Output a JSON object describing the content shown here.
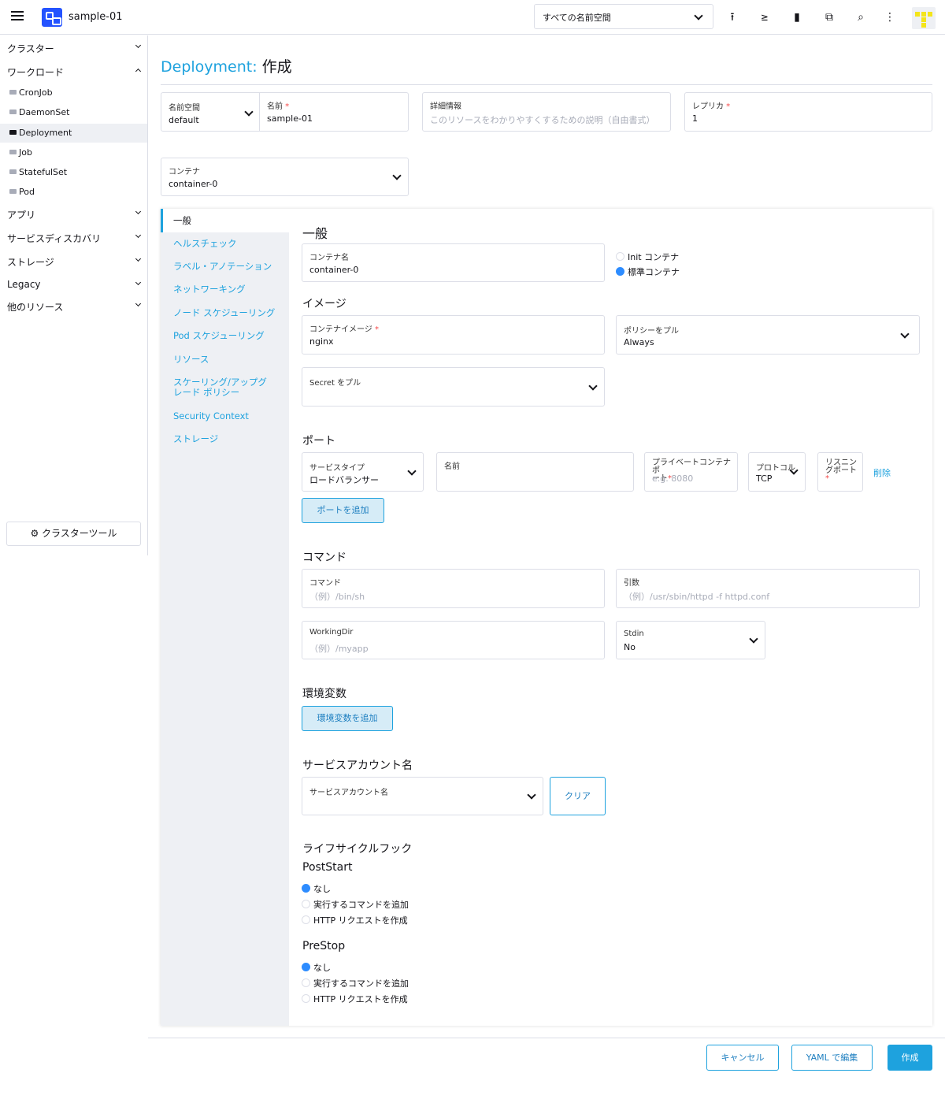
{
  "header": {
    "cluster_name": "sample-01",
    "namespace_select": "すべての名前空間"
  },
  "sidebar": {
    "groups": [
      {
        "label": "クラスター",
        "expanded": false
      },
      {
        "label": "ワークロード",
        "expanded": true
      },
      {
        "label": "アプリ",
        "expanded": false
      },
      {
        "label": "サービスディスカバリ",
        "expanded": false
      },
      {
        "label": "ストレージ",
        "expanded": false
      },
      {
        "label": "Legacy",
        "expanded": false
      },
      {
        "label": "他のリソース",
        "expanded": false
      }
    ],
    "workload_items": [
      "CronJob",
      "DaemonSet",
      "Deployment",
      "Job",
      "StatefulSet",
      "Pod"
    ],
    "active_item": "Deployment",
    "cluster_tool": "クラスターツール"
  },
  "page": {
    "title_type": "Deployment:",
    "title_action": "作成"
  },
  "top_fields": {
    "namespace_label": "名前空間",
    "namespace_value": "default",
    "name_label": "名前",
    "name_value": "sample-01",
    "description_label": "詳細情報",
    "description_placeholder": "このリソースをわかりやすくするための説明（自由書式）",
    "replicas_label": "レプリカ",
    "replicas_value": "1",
    "container_label": "コンテナ",
    "container_value": "container-0"
  },
  "tabs": [
    "一般",
    "ヘルスチェック",
    "ラベル・アノテーション",
    "ネットワーキング",
    "ノード スケジューリング",
    "Pod スケジューリング",
    "リソース",
    "スケーリング/アップグ",
    "レード ポリシー",
    "Security Context",
    "ストレージ"
  ],
  "general": {
    "heading": "一般",
    "container_name_label": "コンテナ名",
    "container_name_value": "container-0",
    "init_container": "Init コンテナ",
    "standard_container": "標準コンテナ"
  },
  "image": {
    "heading": "イメージ",
    "image_label": "コンテナイメージ",
    "image_value": "nginx",
    "pull_policy_label": "ポリシーをプル",
    "pull_policy_value": "Always",
    "pull_secret_label": "Secret をプル"
  },
  "ports": {
    "heading": "ポート",
    "service_type_label": "サービスタイプ",
    "service_type_value": "ロードバランサー",
    "name_label": "名前",
    "private_port_label": "プライベートコンテナポ",
    "private_port_label2": "ート",
    "private_port_placeholder": "e.g. 8080",
    "protocol_label": "プロトコル",
    "protocol_value": "TCP",
    "listening_label": "リスニン",
    "listening_label2": "グポート",
    "remove": "削除",
    "add_port": "ポートを追加"
  },
  "command": {
    "heading": "コマンド",
    "command_label": "コマンド",
    "command_placeholder": "（例）/bin/sh",
    "args_label": "引数",
    "args_placeholder": "（例）/usr/sbin/httpd -f httpd.conf",
    "workdir_label": "WorkingDir",
    "workdir_placeholder": "（例）/myapp",
    "stdin_label": "Stdin",
    "stdin_value": "No"
  },
  "env": {
    "heading": "環境変数",
    "add": "環境変数を追加"
  },
  "service_account": {
    "heading": "サービスアカウント名",
    "label": "サービスアカウント名",
    "clear": "クリア"
  },
  "lifecycle": {
    "heading": "ライフサイクルフック",
    "poststart": "PostStart",
    "prestop": "PreStop",
    "options": [
      "なし",
      "実行するコマンドを追加",
      "HTTP リクエストを作成"
    ]
  },
  "footer": {
    "cancel": "キャンセル",
    "edit_yaml": "YAML で編集",
    "create": "作成"
  }
}
